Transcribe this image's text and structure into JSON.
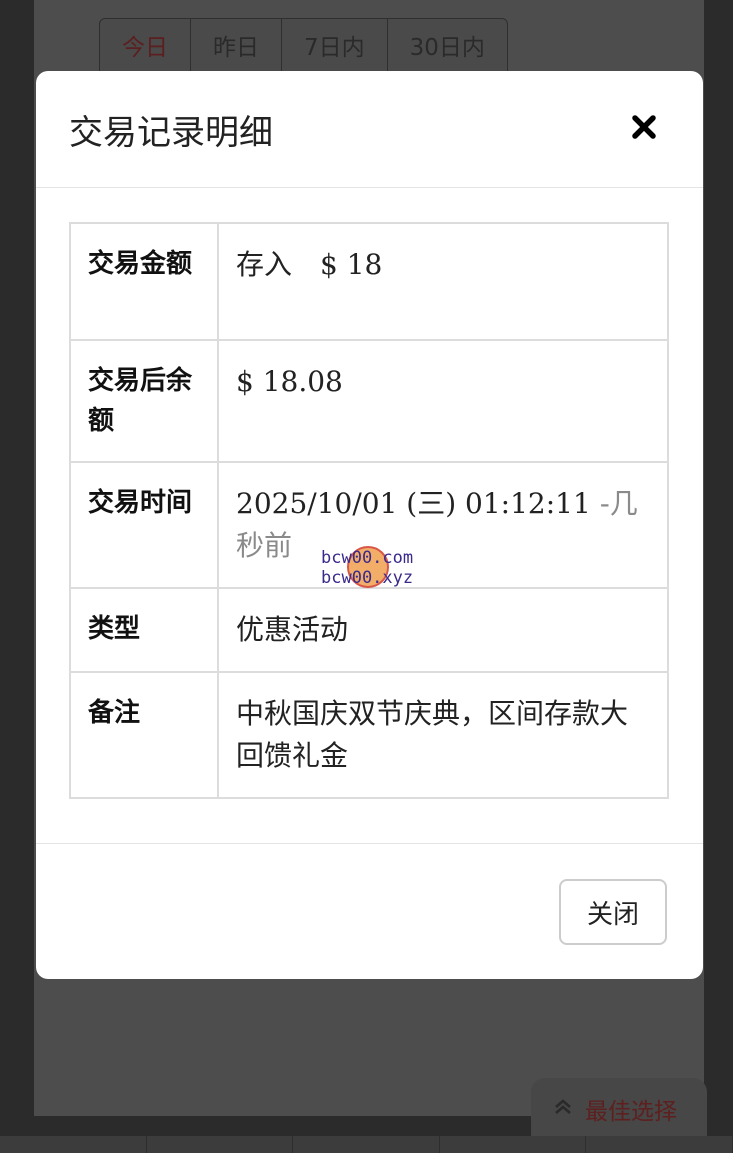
{
  "background": {
    "tabs": [
      "今日",
      "昨日",
      "7日内",
      "30日内"
    ],
    "best_choice_label": "最佳选择"
  },
  "modal": {
    "title": "交易记录明细",
    "rows": [
      {
        "label": "交易金额",
        "value": "存入　$ 18"
      },
      {
        "label": "交易后余额",
        "value": "$ 18.08"
      },
      {
        "label": "交易时间",
        "value": "2025/10/01 (三) 01:12:11",
        "relative": "-几秒前"
      },
      {
        "label": "类型",
        "value": "优惠活动"
      },
      {
        "label": "备注",
        "value": "中秋国庆双节庆典，区间存款大回馈礼金"
      }
    ],
    "close_button": "关闭"
  },
  "watermark": {
    "line1": "bcw00.com",
    "line2": "bcw00.xyz"
  },
  "colors": {
    "deposit_green": "#3c7a3c",
    "active_tab_red": "#5b1f1f"
  }
}
